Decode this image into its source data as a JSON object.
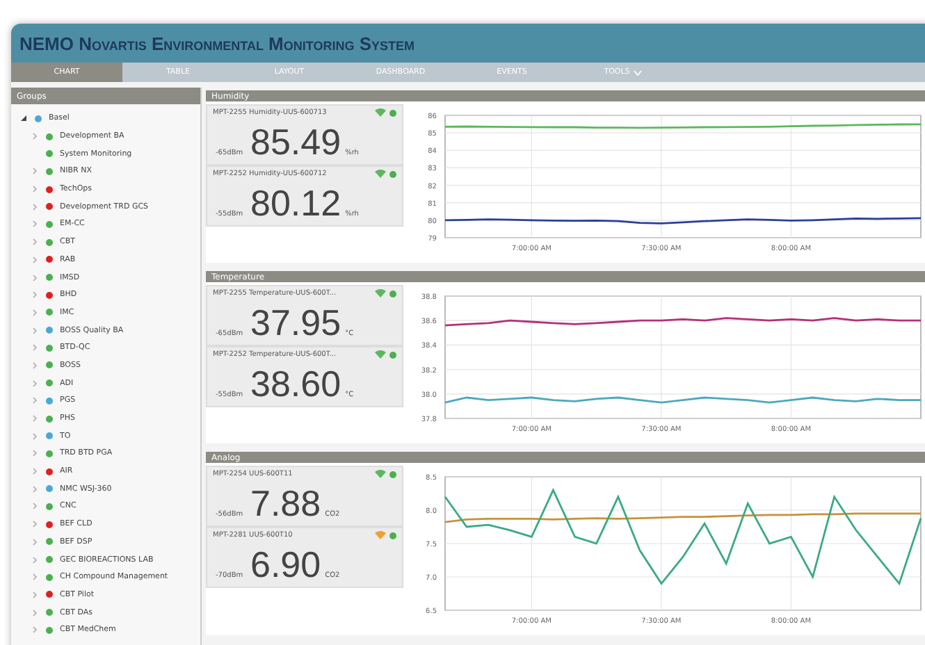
{
  "window": {
    "title": "NEMO Novartis Environmental Monitoring System"
  },
  "tabs": [
    {
      "label": "CHART",
      "selected": true,
      "dropdown": false
    },
    {
      "label": "TABLE",
      "selected": false,
      "dropdown": false
    },
    {
      "label": "LAYOUT",
      "selected": false,
      "dropdown": false
    },
    {
      "label": "DASHBOARD",
      "selected": false,
      "dropdown": false
    },
    {
      "label": "EVENTS",
      "selected": false,
      "dropdown": false
    },
    {
      "label": "TOOLS",
      "selected": false,
      "dropdown": true
    }
  ],
  "groups": {
    "title": "Groups",
    "tree": [
      {
        "label": "Basel",
        "color": "#4aa8d8",
        "expanded": true,
        "children": [
          {
            "label": "Development BA",
            "color": "#4caf50",
            "expandable": true
          },
          {
            "label": "System Monitoring",
            "color": "#4caf50",
            "expandable": false
          },
          {
            "label": "NIBR NX",
            "color": "#4caf50",
            "expandable": true
          },
          {
            "label": "TechOps",
            "color": "#e02020",
            "expandable": true
          },
          {
            "label": "Development TRD GCS",
            "color": "#e02020",
            "expandable": true
          },
          {
            "label": "EM-CC",
            "color": "#4caf50",
            "expandable": true
          },
          {
            "label": "CBT",
            "color": "#4caf50",
            "expandable": true
          },
          {
            "label": "RAB",
            "color": "#e02020",
            "expandable": true
          },
          {
            "label": "IMSD",
            "color": "#4caf50",
            "expandable": true
          },
          {
            "label": "BHD",
            "color": "#e02020",
            "expandable": true
          },
          {
            "label": "IMC",
            "color": "#4caf50",
            "expandable": true
          },
          {
            "label": "BOSS Quality BA",
            "color": "#4aa8d8",
            "expandable": true
          },
          {
            "label": "BTD-QC",
            "color": "#4caf50",
            "expandable": true
          },
          {
            "label": "BOSS",
            "color": "#4caf50",
            "expandable": true
          },
          {
            "label": "ADI",
            "color": "#4caf50",
            "expandable": true
          },
          {
            "label": "PGS",
            "color": "#4aa8d8",
            "expandable": true
          },
          {
            "label": "PHS",
            "color": "#4caf50",
            "expandable": true
          },
          {
            "label": "TO",
            "color": "#4aa8d8",
            "expandable": true
          },
          {
            "label": "TRD BTD PGA",
            "color": "#4caf50",
            "expandable": true
          },
          {
            "label": "AIR",
            "color": "#e02020",
            "expandable": true
          },
          {
            "label": "NMC WSJ-360",
            "color": "#4aa8d8",
            "expandable": true
          },
          {
            "label": "CNC",
            "color": "#4caf50",
            "expandable": true
          },
          {
            "label": "BEF CLD",
            "color": "#e02020",
            "expandable": true
          },
          {
            "label": "BEF DSP",
            "color": "#4caf50",
            "expandable": true
          },
          {
            "label": "GEC BIOREACTIONS LAB",
            "color": "#4caf50",
            "expandable": true
          },
          {
            "label": "CH Compound Management",
            "color": "#4caf50",
            "expandable": true
          },
          {
            "label": "CBT Pilot",
            "color": "#e02020",
            "expandable": true
          },
          {
            "label": "CBT DAs",
            "color": "#4caf50",
            "expandable": true
          },
          {
            "label": "CBT MedChem",
            "color": "#4caf50",
            "expandable": true
          }
        ]
      }
    ]
  },
  "panels": [
    {
      "title": "Humidity",
      "sensors": [
        {
          "name": "MPT-2255 Humidity-UUS-600713",
          "rssi": "-65dBm",
          "value": "85.49",
          "unit": "%rh",
          "weak_signal": false,
          "color": "#4caf50"
        },
        {
          "name": "MPT-2252 Humidity-UUS-600712",
          "rssi": "-55dBm",
          "value": "80.12",
          "unit": "%rh",
          "weak_signal": false,
          "color": "#4caf50"
        }
      ],
      "chart_data": {
        "type": "line",
        "categories": [
          null,
          null,
          null,
          null,
          "7:00:00 AM",
          null,
          null,
          null,
          null,
          null,
          "7:30:00 AM",
          null,
          null,
          null,
          null,
          null,
          "8:00:00 AM",
          null,
          null,
          null,
          null,
          null,
          null
        ],
        "ylim": [
          79,
          86
        ],
        "grid": true,
        "yticks": [
          {
            "value": 86,
            "label": "86"
          },
          {
            "value": 85,
            "label": "85"
          },
          {
            "value": 84,
            "label": "84"
          },
          {
            "value": 83,
            "label": "83"
          },
          {
            "value": 82,
            "label": "82"
          },
          {
            "value": 81,
            "label": "81"
          },
          {
            "value": 80,
            "label": "80"
          },
          {
            "value": 79,
            "label": "79"
          }
        ],
        "series": [
          {
            "color": "#5cb85c",
            "values": [
              85.35,
              85.36,
              85.35,
              85.34,
              85.33,
              85.32,
              85.32,
              85.3,
              85.3,
              85.29,
              85.3,
              85.31,
              85.32,
              85.33,
              85.34,
              85.35,
              85.38,
              85.4,
              85.42,
              85.45,
              85.47,
              85.48,
              85.49
            ]
          },
          {
            "color": "#2a3f9a",
            "values": [
              80.0,
              80.02,
              80.05,
              80.03,
              80.0,
              79.98,
              79.97,
              79.98,
              79.95,
              79.85,
              79.82,
              79.88,
              79.95,
              80.0,
              80.05,
              80.02,
              79.98,
              80.0,
              80.05,
              80.1,
              80.08,
              80.1,
              80.12
            ]
          }
        ]
      }
    },
    {
      "title": "Temperature",
      "sensors": [
        {
          "name": "MPT-2255 Temperature-UUS-600T...",
          "rssi": "-65dBm",
          "value": "37.95",
          "unit": "°C",
          "weak_signal": false,
          "color": "#4caf50"
        },
        {
          "name": "MPT-2252 Temperature-UUS-600T...",
          "rssi": "-55dBm",
          "value": "38.60",
          "unit": "°C",
          "weak_signal": false,
          "color": "#4caf50"
        }
      ],
      "chart_data": {
        "type": "line",
        "categories": [
          null,
          null,
          null,
          null,
          "7:00:00 AM",
          null,
          null,
          null,
          null,
          null,
          "7:30:00 AM",
          null,
          null,
          null,
          null,
          null,
          "8:00:00 AM",
          null,
          null,
          null,
          null,
          null,
          null
        ],
        "ylim": [
          37.8,
          38.8
        ],
        "grid": true,
        "yticks": [
          {
            "value": 38.8,
            "label": "38.8"
          },
          {
            "value": 38.6,
            "label": "38.6"
          },
          {
            "value": 38.4,
            "label": "38.4"
          },
          {
            "value": 38.2,
            "label": "38.2"
          },
          {
            "value": 38.0,
            "label": "38.0"
          },
          {
            "value": 37.8,
            "label": "37.8"
          }
        ],
        "series": [
          {
            "color": "#b5307a",
            "values": [
              38.56,
              38.57,
              38.58,
              38.6,
              38.59,
              38.58,
              38.57,
              38.58,
              38.59,
              38.6,
              38.6,
              38.61,
              38.6,
              38.62,
              38.61,
              38.6,
              38.61,
              38.6,
              38.62,
              38.6,
              38.61,
              38.6,
              38.6
            ]
          },
          {
            "color": "#4aa8c0",
            "values": [
              37.93,
              37.97,
              37.95,
              37.96,
              37.97,
              37.95,
              37.94,
              37.96,
              37.97,
              37.95,
              37.93,
              37.95,
              37.97,
              37.96,
              37.95,
              37.93,
              37.95,
              37.97,
              37.95,
              37.94,
              37.96,
              37.95,
              37.95
            ]
          }
        ]
      }
    },
    {
      "title": "Analog",
      "sensors": [
        {
          "name": "MPT-2254 UUS-600T11",
          "rssi": "-56dBm",
          "value": "7.88",
          "unit": "CO2",
          "weak_signal": false,
          "color": "#4caf50"
        },
        {
          "name": "MPT-2281 UUS-600T10",
          "rssi": "-70dBm",
          "value": "6.90",
          "unit": "CO2",
          "weak_signal": true,
          "color": "#4caf50"
        }
      ],
      "chart_data": {
        "type": "line",
        "categories": [
          null,
          null,
          null,
          null,
          "7:00:00 AM",
          null,
          null,
          null,
          null,
          null,
          "7:30:00 AM",
          null,
          null,
          null,
          null,
          null,
          "8:00:00 AM",
          null,
          null,
          null,
          null,
          null,
          null
        ],
        "ylim": [
          6.5,
          8.5
        ],
        "grid": true,
        "yticks": [
          {
            "value": 8.5,
            "label": "8.5"
          },
          {
            "value": 8.0,
            "label": "8.0"
          },
          {
            "value": 7.5,
            "label": "7.5"
          },
          {
            "value": 7.0,
            "label": "7.0"
          },
          {
            "value": 6.5,
            "label": "6.5"
          }
        ],
        "series": [
          {
            "color": "#c8913a",
            "values": [
              7.82,
              7.86,
              7.87,
              7.87,
              7.87,
              7.86,
              7.87,
              7.88,
              7.87,
              7.88,
              7.89,
              7.9,
              7.9,
              7.91,
              7.92,
              7.93,
              7.93,
              7.94,
              7.94,
              7.95,
              7.95,
              7.95,
              7.95
            ]
          },
          {
            "color": "#3aaa85",
            "values": [
              8.2,
              7.75,
              7.78,
              7.7,
              7.6,
              8.3,
              7.6,
              7.5,
              8.2,
              7.4,
              6.9,
              7.3,
              7.8,
              7.2,
              8.1,
              7.5,
              7.6,
              7.0,
              8.2,
              7.7,
              7.3,
              6.9,
              7.88
            ]
          }
        ]
      }
    }
  ]
}
